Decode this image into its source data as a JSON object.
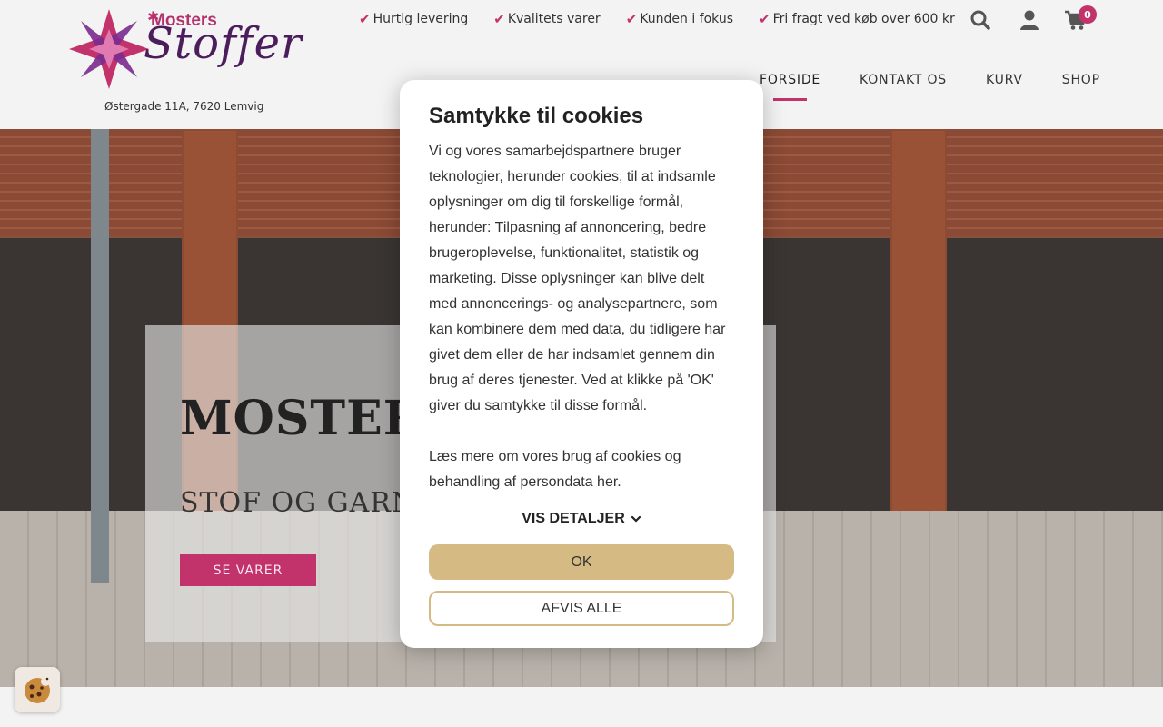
{
  "header": {
    "logo": {
      "top_text": "Mosters",
      "script_text": "Stoffer",
      "address": "Østergade 11A, 7620 Lemvig"
    },
    "usps": [
      {
        "label": "Hurtig levering"
      },
      {
        "label": "Kvalitets varer"
      },
      {
        "label": "Kunden i fokus"
      },
      {
        "label": "Fri fragt ved køb over 600 kr"
      }
    ],
    "icons": {
      "search": "search-icon",
      "account": "user-icon",
      "cart": "cart-icon"
    },
    "cart_count": "0",
    "nav": [
      {
        "label": "FORSIDE",
        "active": true
      },
      {
        "label": "KONTAKT OS",
        "active": false
      },
      {
        "label": "KURV",
        "active": false
      },
      {
        "label": "SHOP",
        "active": false
      }
    ]
  },
  "hero": {
    "title": "MOSTERS STOFFER",
    "subtitle": "STOF OG GARN TIL ALLE",
    "cta_label": "SE VARER"
  },
  "cookie_modal": {
    "title": "Samtykke til cookies",
    "paragraph_1": "Vi og vores samarbejdspartnere bruger teknologier, herunder cookies, til at indsamle oplysninger om dig til forskellige formål, herunder: Tilpasning af annoncering, bedre brugeroplevelse, funktionalitet, statistik og marketing. Disse oplysninger kan blive delt med annoncerings- og analysepartnere, som kan kombinere dem med data, du tidligere har givet dem eller de har indsamlet gennem din brug af deres tjenester. Ved at klikke på 'OK' giver du samtykke til disse formål.",
    "paragraph_2": "Læs mere om vores brug af cookies og behandling af persondata her.",
    "details_label": "VIS DETALJER",
    "ok_label": "OK",
    "reject_label": "AFVIS ALLE"
  },
  "colors": {
    "accent": "#c2326b",
    "modal_button": "#d5bb83"
  }
}
